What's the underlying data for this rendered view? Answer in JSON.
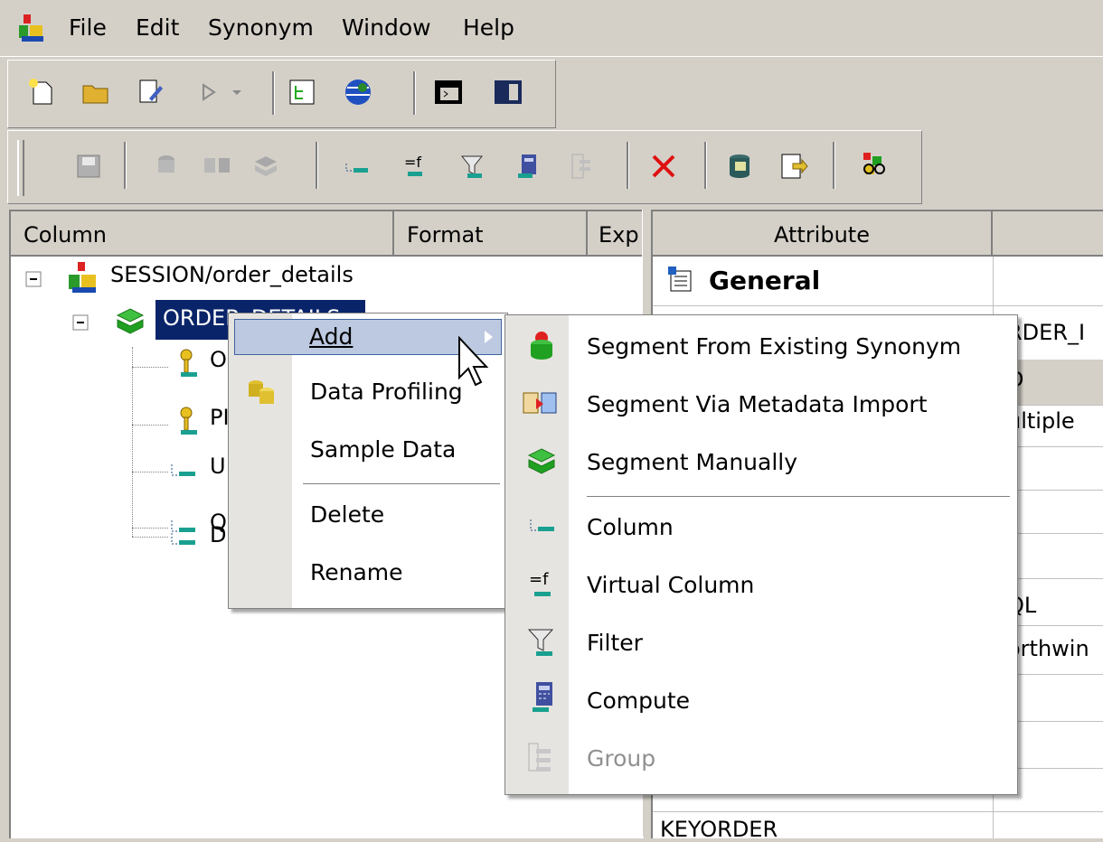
{
  "menubar": {
    "items": [
      {
        "label": "File"
      },
      {
        "label": "Edit"
      },
      {
        "label": "Synonym"
      },
      {
        "label": "Window"
      },
      {
        "label": "Help"
      }
    ]
  },
  "left_pane": {
    "columns": [
      "Column",
      "Format",
      "Exp"
    ],
    "tree": {
      "root": "SESSION/order_details",
      "segment": "ORDER_DETAILS",
      "children": [
        "O",
        "PI",
        "U",
        "Q",
        "D"
      ]
    }
  },
  "right_pane": {
    "columns": [
      "Attribute"
    ],
    "section": "General",
    "values": [
      "RDER_I",
      "D",
      "ultiple",
      "QL",
      "orthwin"
    ],
    "bottom_row": "KEYORDER"
  },
  "context_menu": {
    "items": [
      {
        "label": "Add",
        "underline": "",
        "has_submenu": true,
        "highlighted": true
      },
      {
        "label": "Data Profiling"
      },
      {
        "label": "Sample Data"
      },
      {
        "label": "Delete"
      },
      {
        "label": "Rename"
      }
    ]
  },
  "submenu": {
    "items": [
      {
        "label": "Segment From Existing Synonym",
        "icon": "segment-existing-icon"
      },
      {
        "label": "Segment Via Metadata Import",
        "icon": "metadata-import-icon"
      },
      {
        "label": "Segment Manually",
        "icon": "segment-manual-icon"
      },
      {
        "label": "Column",
        "icon": "column-icon"
      },
      {
        "label": "Virtual Column",
        "icon": "virtual-column-icon"
      },
      {
        "label": "Filter",
        "icon": "filter-icon"
      },
      {
        "label": "Compute",
        "icon": "compute-icon"
      },
      {
        "label": "Group",
        "icon": "group-icon",
        "disabled": true
      }
    ]
  },
  "colors": {
    "chrome": "#d4d0c8",
    "selection": "#0a246a",
    "menu_highlight": "#bcc9e0",
    "disabled_text": "#909090"
  }
}
